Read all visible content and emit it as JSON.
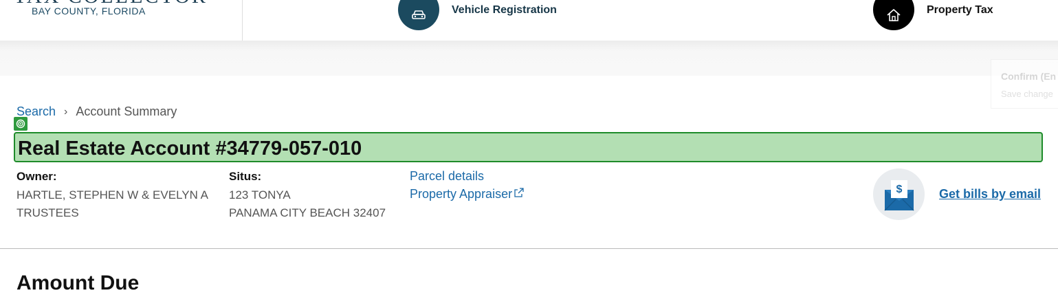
{
  "header": {
    "logo_line1": "TAX COLLECTOR",
    "logo_line2": "BAY COUNTY, FLORIDA",
    "nav": [
      {
        "label": "Vehicle Registration",
        "icon": "car-icon"
      },
      {
        "label": "Property Tax",
        "icon": "house-icon"
      }
    ]
  },
  "popup": {
    "title": "Confirm (En",
    "subtitle": "Save change"
  },
  "breadcrumb": {
    "search_label": "Search",
    "current_label": "Account Summary"
  },
  "account": {
    "title": "Real Estate Account #34779-057-010",
    "owner_label": "Owner:",
    "owner_line1": "HARTLE, STEPHEN W & EVELYN A",
    "owner_line2": "TRUSTEES",
    "situs_label": "Situs:",
    "situs_line1": "123 TONYA",
    "situs_line2": "PANAMA CITY BEACH 32407",
    "parcel_link": "Parcel details",
    "appraiser_link": "Property Appraiser",
    "bills_link": "Get bills by email"
  },
  "section": {
    "amount_due": "Amount Due"
  },
  "colors": {
    "link": "#1b6aa8",
    "highlight": "#b3dfb3",
    "nav_vehicle": "#1b4a5f"
  }
}
